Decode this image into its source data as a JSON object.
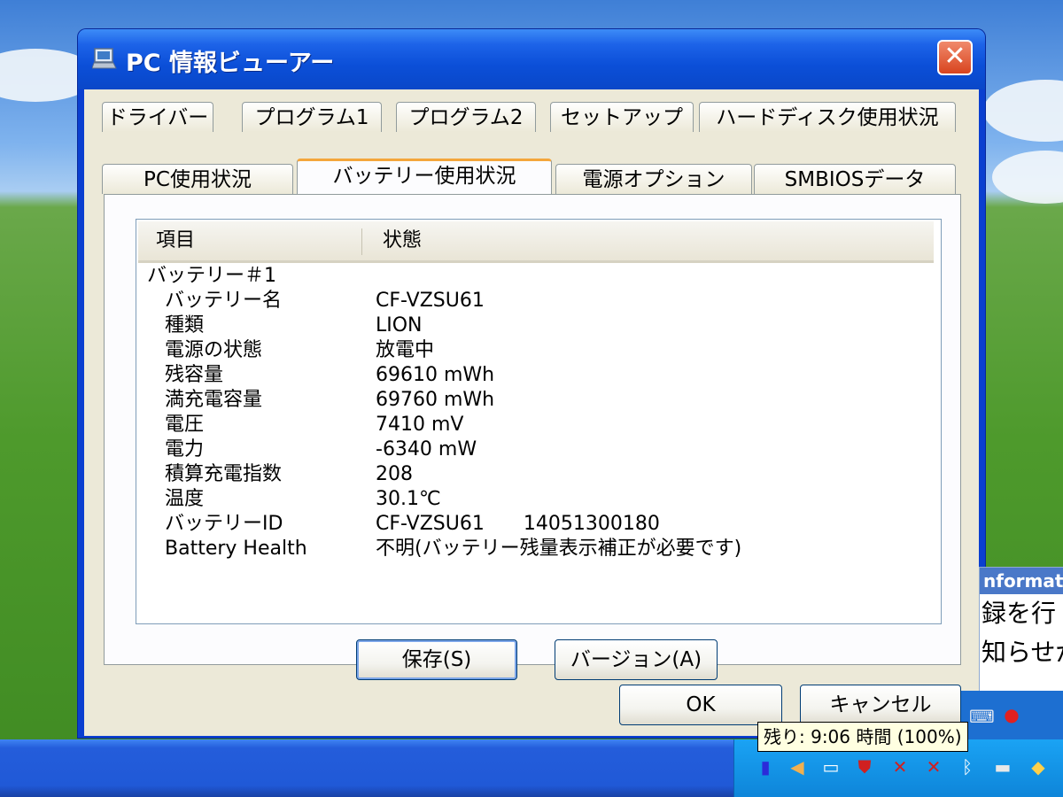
{
  "window": {
    "title": "PC 情報ビューアー",
    "close_glyph": "✕"
  },
  "tabs": {
    "row1": [
      {
        "label": "ドライバー"
      },
      {
        "label": "プログラム1"
      },
      {
        "label": "プログラム2"
      },
      {
        "label": "セットアップ"
      },
      {
        "label": "ハードディスク使用状況"
      }
    ],
    "row2": [
      {
        "label": "PC使用状況"
      },
      {
        "label": "バッテリー使用状況",
        "active": true
      },
      {
        "label": "電源オプション"
      },
      {
        "label": "SMBIOSデータ"
      }
    ]
  },
  "list": {
    "columns": [
      "項目",
      "状態"
    ],
    "group": "バッテリー＃1",
    "rows": [
      {
        "name": "バッテリー名",
        "value": "CF-VZSU61"
      },
      {
        "name": "種類",
        "value": "LION"
      },
      {
        "name": "電源の状態",
        "value": "放電中"
      },
      {
        "name": "残容量",
        "value": "69610 mWh"
      },
      {
        "name": "満充電容量",
        "value": "69760 mWh"
      },
      {
        "name": "電圧",
        "value": "7410 mV"
      },
      {
        "name": "電力",
        "value": "-6340 mW"
      },
      {
        "name": "積算充電指数",
        "value": "208"
      },
      {
        "name": "温度",
        "value": "30.1℃"
      },
      {
        "name": "バッテリーID",
        "value": "CF-VZSU61　　14051300180"
      },
      {
        "name": "Battery Health",
        "value": "不明(バッテリー残量表示補正が必要です)"
      }
    ]
  },
  "buttons": {
    "save": "保存(S)",
    "version": "バージョン(A)",
    "ok": "OK",
    "cancel": "キャンセル"
  },
  "tooltip": {
    "text": "残り: 9:06 時間 (100%)"
  },
  "background_panel": {
    "header": "nformat",
    "line1": "録を行",
    "line2": "知らせが"
  },
  "colors": {
    "title_bar": "#0a47c8",
    "dialog_face": "#ece9d8",
    "active_tab_accent": "#f4a63c",
    "close_button": "#d8431e"
  }
}
